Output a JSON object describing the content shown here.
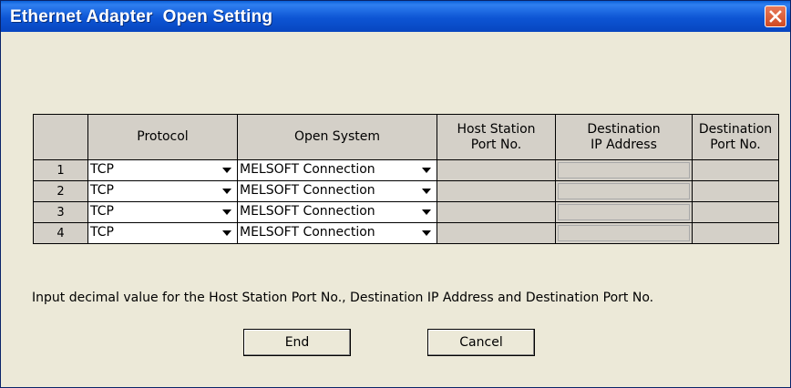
{
  "window": {
    "title": "Ethernet Adapter  Open Setting"
  },
  "table": {
    "headers": {
      "num": "",
      "protocol": "Protocol",
      "open_system": "Open System",
      "host_port_1": "Host Station",
      "host_port_2": "Port No.",
      "dest_ip_1": "Destination",
      "dest_ip_2": "IP Address",
      "dest_port_1": "Destination",
      "dest_port_2": "Port No."
    },
    "rows": [
      {
        "num": "1",
        "protocol": "TCP",
        "open_system": "MELSOFT Connection"
      },
      {
        "num": "2",
        "protocol": "TCP",
        "open_system": "MELSOFT Connection"
      },
      {
        "num": "3",
        "protocol": "TCP",
        "open_system": "MELSOFT Connection"
      },
      {
        "num": "4",
        "protocol": "TCP",
        "open_system": "MELSOFT Connection"
      }
    ]
  },
  "info": "Input decimal value for the Host Station Port No., Destination IP Address and Destination Port No.",
  "buttons": {
    "end": "End",
    "cancel": "Cancel"
  },
  "icons": {
    "close": "close-icon",
    "dropdown": "chevron-down-icon"
  }
}
